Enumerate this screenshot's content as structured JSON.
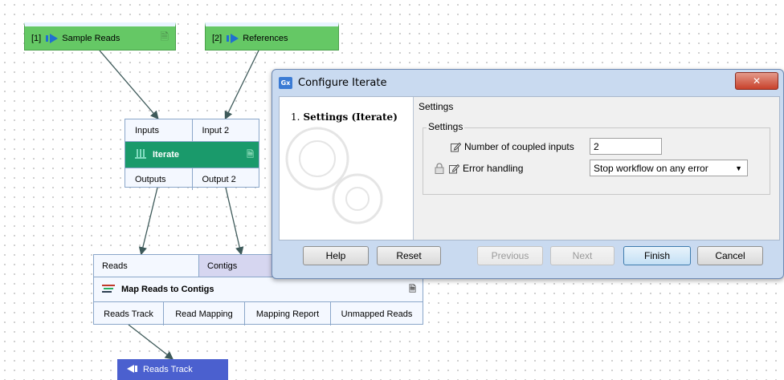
{
  "workflow": {
    "input_nodes": [
      {
        "label": "[1]",
        "name": "Sample Reads"
      },
      {
        "label": "[2]",
        "name": "References"
      }
    ],
    "iterate": {
      "inputs_label": "Inputs",
      "input2_label": "Input 2",
      "name": "Iterate",
      "outputs_label": "Outputs",
      "output2_label": "Output 2"
    },
    "map": {
      "top": [
        "Reads",
        "Contigs"
      ],
      "name": "Map Reads to Contigs",
      "outputs": [
        "Reads Track",
        "Read Mapping",
        "Mapping Report",
        "Unmapped Reads"
      ]
    },
    "output_node": {
      "name": "Reads Track"
    }
  },
  "dialog": {
    "title": "Configure Iterate",
    "close_label": "✕",
    "step_number": "1.",
    "step_name": "Settings (Iterate)",
    "header": "Settings",
    "group_label": "Settings",
    "field_coupled_label": "Number of coupled inputs",
    "field_coupled_value": "2",
    "field_error_label": "Error handling",
    "field_error_value": "Stop workflow on any error",
    "buttons": {
      "help": "Help",
      "reset": "Reset",
      "previous": "Previous",
      "next": "Next",
      "finish": "Finish",
      "cancel": "Cancel"
    }
  },
  "colors": {
    "input_node": "#65c865",
    "iterate_bar": "#1a9a6b",
    "output_node": "#4b60cf"
  }
}
